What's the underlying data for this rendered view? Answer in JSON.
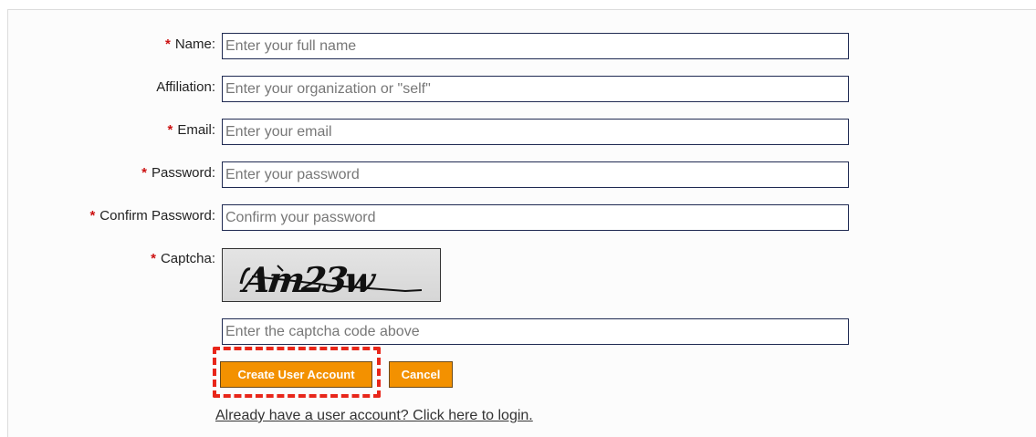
{
  "form": {
    "required_marker": "*",
    "name": {
      "label": "Name:",
      "placeholder": "Enter your full name",
      "value": ""
    },
    "affiliation": {
      "label": "Affiliation:",
      "placeholder": "Enter your organization or \"self\"",
      "value": ""
    },
    "email": {
      "label": "Email:",
      "placeholder": "Enter your email",
      "value": ""
    },
    "password": {
      "label": "Password:",
      "placeholder": "Enter your password",
      "value": ""
    },
    "confirm_password": {
      "label": "Confirm Password:",
      "placeholder": "Confirm your password",
      "value": ""
    },
    "captcha": {
      "label": "Captcha:",
      "image_text": "Am23w",
      "placeholder": "Enter the captcha code above",
      "value": ""
    }
  },
  "buttons": {
    "create_label": "Create User Account",
    "cancel_label": "Cancel"
  },
  "login_link": "Already have a user account? Click here to login.",
  "colors": {
    "button_bg": "#f39100",
    "required_marker": "#cc1111",
    "highlight_border": "#e8261a",
    "input_border": "#1f2a52"
  }
}
